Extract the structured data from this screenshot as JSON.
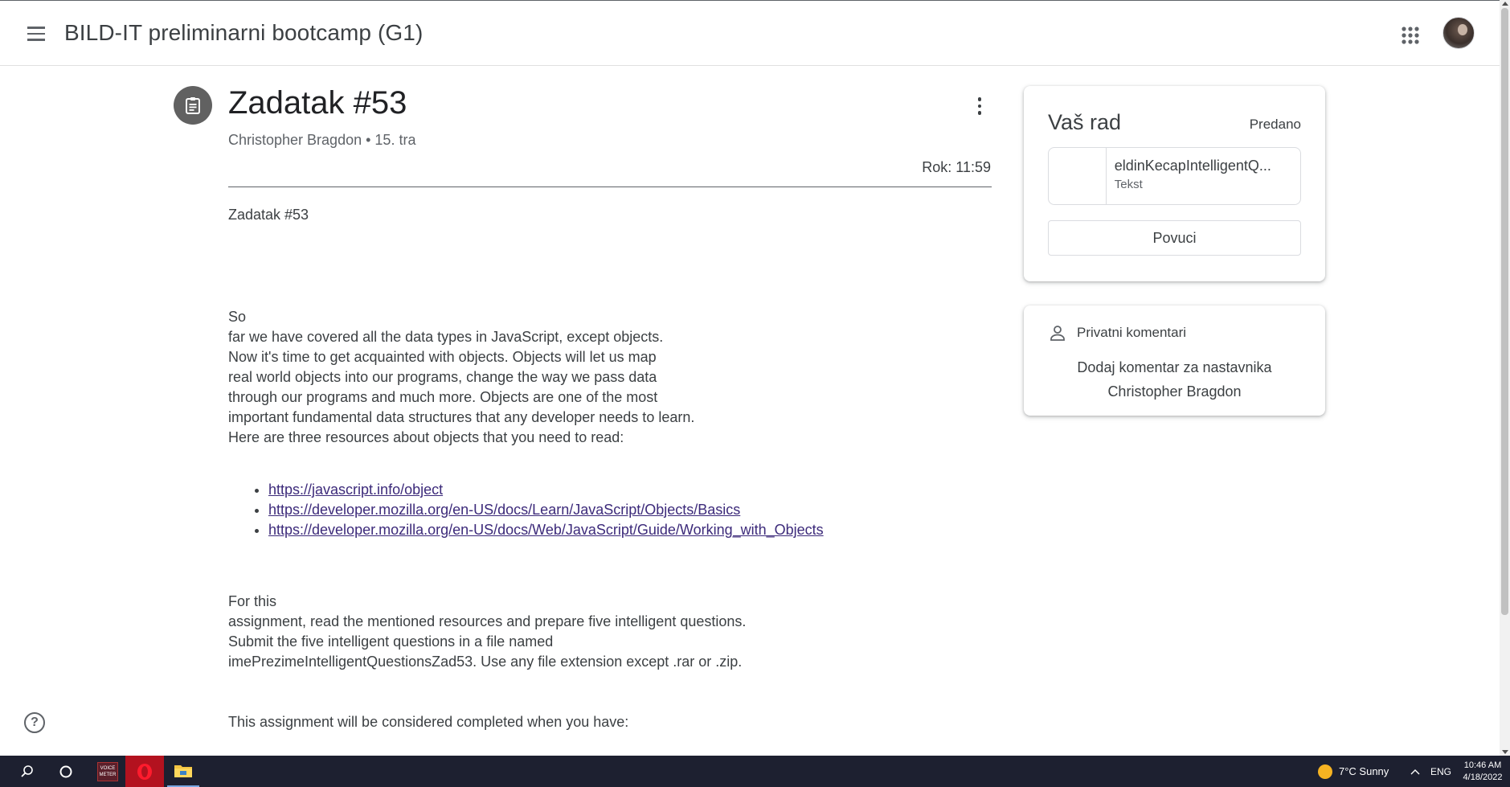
{
  "header": {
    "app_title": "BILD-IT preliminarni bootcamp (G1)"
  },
  "assignment": {
    "title": "Zadatak #53",
    "author": "Christopher Bragdon",
    "date": "15. tra",
    "meta_separator": " • ",
    "due": "Rok: 11:59",
    "body": {
      "heading": "Zadatak #53",
      "intro_lines": [
        "So",
        "far we have covered all the data types in JavaScript, except objects.",
        "Now it's time to get acquainted with objects. Objects will let us map",
        "real world objects into our programs, change the way we pass data",
        "through our programs and much more. Objects are one of the most",
        "important fundamental data structures that any developer needs to learn.",
        "Here are three resources about objects that you need to read:"
      ],
      "links": [
        "https://javascript.info/object",
        "https://developer.mozilla.org/en-US/docs/Learn/JavaScript/Objects/Basics",
        "https://developer.mozilla.org/en-US/docs/Web/JavaScript/Guide/Working_with_Objects"
      ],
      "task_lines": [
        "For this",
        "assignment, read the mentioned resources and prepare five intelligent questions.",
        "Submit the five intelligent questions in a file named",
        "imePrezimeIntelligentQuestionsZad53. Use any file extension except .rar or .zip."
      ],
      "completion_line": "This assignment will be considered completed when you have:"
    }
  },
  "your_work": {
    "title": "Vaš rad",
    "status": "Predano",
    "file_name": "eldinKecapIntelligentQ...",
    "file_type": "Tekst",
    "unsubmit_label": "Povuci"
  },
  "private_comments": {
    "title": "Privatni komentari",
    "add_label": "Dodaj komentar za nastavnika Christopher Bragdon"
  },
  "taskbar": {
    "voicemeeter_label": "VOICE METER",
    "weather": "7°C  Sunny",
    "language": "ENG",
    "time": "10:46 AM",
    "date": "4/18/2022"
  },
  "icons": {
    "menu": "menu-icon",
    "apps": "apps-grid-icon",
    "assignment": "assignment-icon",
    "more": "more-vert-icon",
    "person": "person-icon",
    "help": "help-icon",
    "search": "search-icon",
    "cortana": "cortana-icon",
    "opera": "opera-icon",
    "explorer": "file-explorer-icon",
    "weather": "sun-icon"
  }
}
